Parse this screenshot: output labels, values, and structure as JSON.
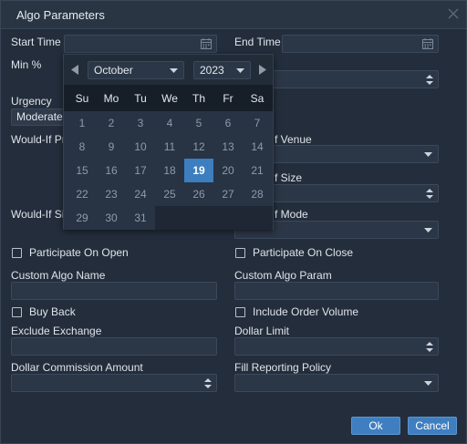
{
  "dialog": {
    "title": "Algo Parameters"
  },
  "fields": {
    "start_time_label": "Start Time",
    "end_time_label": "End Time",
    "min_pct_label": "Min %",
    "urgency_label": "Urgency",
    "urgency_value": "Moderate",
    "would_if_price_label": "Would-If Pr",
    "venue_label": "f Venue",
    "size_label": "f Size",
    "would_if_si_label": "Would-If Si",
    "mode_label": "f Mode",
    "participate_open_label": "Participate On Open",
    "participate_close_label": "Participate On Close",
    "custom_algo_name_label": "Custom Algo Name",
    "custom_algo_param_label": "Custom Algo Param",
    "buy_back_label": "Buy Back",
    "include_order_volume_label": "Include Order Volume",
    "exclude_exchange_label": "Exclude Exchange",
    "dollar_limit_label": "Dollar Limit",
    "dollar_commission_label": "Dollar Commission Amount",
    "fill_reporting_label": "Fill Reporting Policy"
  },
  "calendar": {
    "month": "October",
    "year": "2023",
    "weekdays": [
      "Su",
      "Mo",
      "Tu",
      "We",
      "Th",
      "Fr",
      "Sa"
    ],
    "weeks": [
      [
        "1",
        "2",
        "3",
        "4",
        "5",
        "6",
        "7"
      ],
      [
        "8",
        "9",
        "10",
        "11",
        "12",
        "13",
        "14"
      ],
      [
        "15",
        "16",
        "17",
        "18",
        "19",
        "20",
        "21"
      ],
      [
        "22",
        "23",
        "24",
        "25",
        "26",
        "27",
        "28"
      ],
      [
        "29",
        "30",
        "31"
      ]
    ],
    "selected_day": "19"
  },
  "buttons": {
    "ok": "Ok",
    "cancel": "Cancel"
  },
  "colors": {
    "accent": "#3d7ec0",
    "background": "#232d3b"
  }
}
